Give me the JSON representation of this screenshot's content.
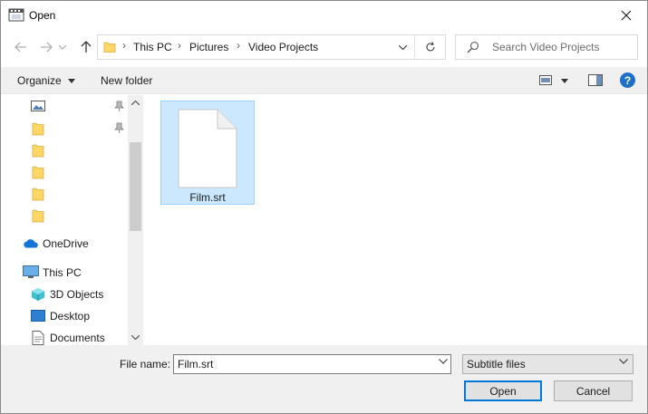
{
  "window": {
    "title": "Open"
  },
  "address": {
    "breadcrumbs": [
      "This PC",
      "Pictures",
      "Video Projects"
    ]
  },
  "search": {
    "placeholder": "Search Video Projects"
  },
  "commandbar": {
    "organize_label": "Organize",
    "new_folder_label": "New folder"
  },
  "navpane": {
    "items": [
      {
        "label": "",
        "icon": "pictures-icon",
        "pinned": true
      },
      {
        "label": "",
        "icon": "folder-icon",
        "pinned": true
      },
      {
        "label": "",
        "icon": "folder-icon"
      },
      {
        "label": "",
        "icon": "folder-icon"
      },
      {
        "label": "",
        "icon": "folder-icon"
      },
      {
        "label": "",
        "icon": "folder-icon"
      },
      {
        "label": "OneDrive",
        "icon": "onedrive-icon"
      },
      {
        "label": "This PC",
        "icon": "this-pc-icon"
      },
      {
        "label": "3D Objects",
        "icon": "3d-objects-icon"
      },
      {
        "label": "Desktop",
        "icon": "desktop-icon"
      },
      {
        "label": "Documents",
        "icon": "documents-icon"
      }
    ]
  },
  "files": [
    {
      "name": "Film.srt",
      "selected": true,
      "icon": "blank-file-icon"
    }
  ],
  "bottom": {
    "file_name_label": "File name:",
    "file_name_value": "Film.srt",
    "file_type_value": "Subtitle files",
    "open_label": "Open",
    "cancel_label": "Cancel"
  },
  "colors": {
    "accent": "#0078d7",
    "selection": "#cce8ff",
    "folder": "#ffd766",
    "help": "#1e70c8"
  }
}
